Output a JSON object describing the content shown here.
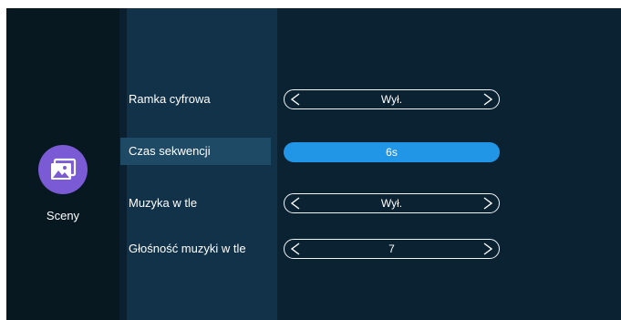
{
  "sidebar": {
    "active_item": {
      "label": "Sceny",
      "icon": "image-gallery-icon"
    }
  },
  "settings": {
    "rows": [
      {
        "label": "Ramka cyfrowa",
        "value": "Wył."
      },
      {
        "label": "Czas sekwencji",
        "value": "6s",
        "selected": true
      },
      {
        "label": "Muzyka w tle",
        "value": "Wył."
      },
      {
        "label": "Głośność muzyki w tle",
        "value": "7"
      }
    ]
  },
  "colors": {
    "background": "#0a2232",
    "sidebar": "#071821",
    "label_column": "#123249",
    "selected_row": "#1e4a66",
    "accent": "#2196e6",
    "icon_circle": "#7b5ad6"
  }
}
